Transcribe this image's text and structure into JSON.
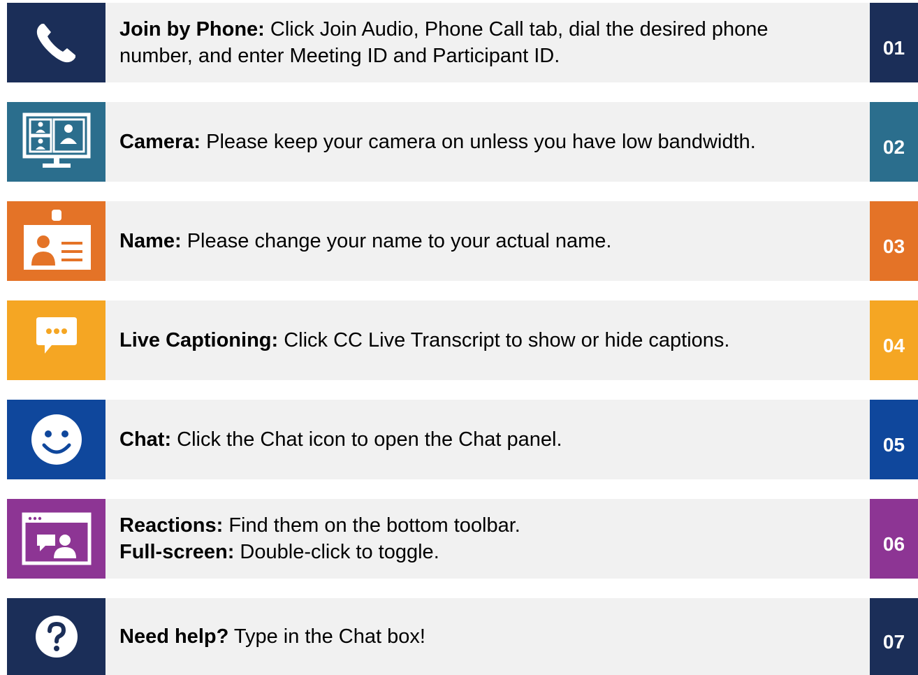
{
  "items": [
    {
      "number": "01",
      "icon": "phone-icon",
      "color": "#1b2e58",
      "lines": [
        {
          "bold": "Join by Phone:",
          "text": " Click Join Audio, Phone Call tab, dial the desired phone"
        },
        {
          "bold": "",
          "text": "number, and enter Meeting ID and Participant ID."
        }
      ]
    },
    {
      "number": "02",
      "icon": "video-gallery-icon",
      "color": "#2b6e8d",
      "lines": [
        {
          "bold": "Camera:",
          "text": " Please keep your camera on unless you have low bandwidth."
        }
      ]
    },
    {
      "number": "03",
      "icon": "id-badge-icon",
      "color": "#e47327",
      "lines": [
        {
          "bold": "Name:",
          "text": " Please change your name to your actual name."
        }
      ]
    },
    {
      "number": "04",
      "icon": "speech-bubble-icon",
      "color": "#f5a623",
      "lines": [
        {
          "bold": "Live Captioning:",
          "text": " Click CC Live Transcript to show or hide captions."
        }
      ]
    },
    {
      "number": "05",
      "icon": "smiley-icon",
      "color": "#0f479c",
      "lines": [
        {
          "bold": "Chat:",
          "text": " Click the Chat icon to open the Chat panel."
        }
      ]
    },
    {
      "number": "06",
      "icon": "screen-share-icon",
      "color": "#8d3594",
      "lines": [
        {
          "bold": "Reactions:",
          "text": " Find them on the bottom toolbar."
        },
        {
          "bold": "Full-screen:",
          "text": " Double-click to toggle."
        }
      ]
    },
    {
      "number": "07",
      "icon": "question-icon",
      "color": "#1b2e58",
      "lines": [
        {
          "bold": "Need help?",
          "text": " Type in the Chat box!"
        }
      ]
    }
  ]
}
